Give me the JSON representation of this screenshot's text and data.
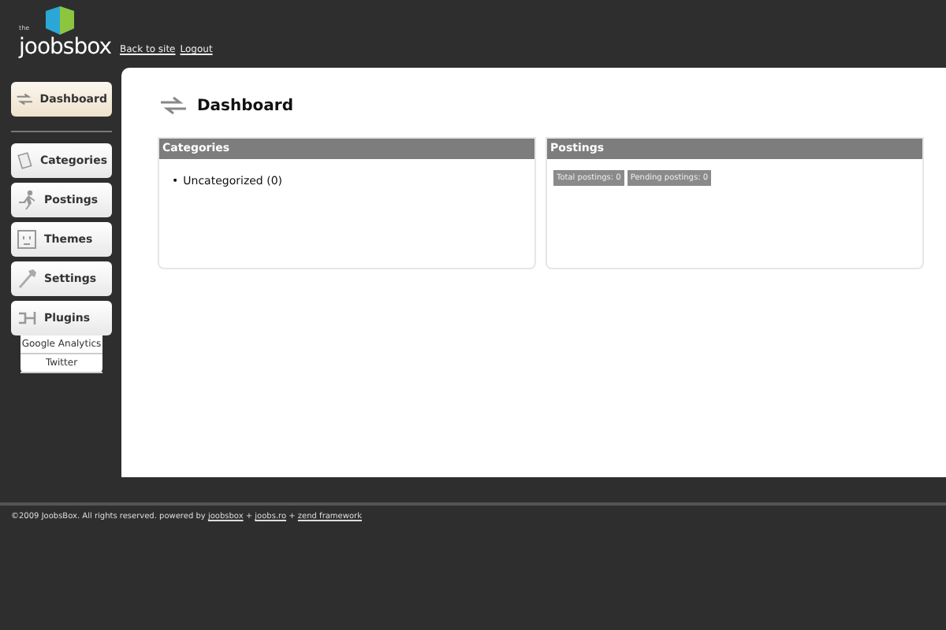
{
  "header": {
    "logo_small": "the",
    "logo": "joobsbox",
    "links": [
      "Back to site",
      "Logout"
    ]
  },
  "sidebar": {
    "items": [
      {
        "label": "Dashboard",
        "selected": true
      },
      {
        "label": "Categories",
        "selected": false
      },
      {
        "label": "Postings",
        "selected": false
      },
      {
        "label": "Themes",
        "selected": false
      },
      {
        "label": "Settings",
        "selected": false
      },
      {
        "label": "Plugins",
        "selected": false
      }
    ],
    "subitems": [
      "Google Analytics",
      "Twitter"
    ]
  },
  "page": {
    "title": "Dashboard"
  },
  "panels": [
    {
      "title": "Categories",
      "kind": "list",
      "marker": "•",
      "items": [
        "Uncategorized (0)"
      ]
    },
    {
      "title": "Postings",
      "kind": "tags",
      "items": [
        "Total postings: 0",
        "Pending postings: 0"
      ]
    }
  ],
  "footer": {
    "text": "©2009 JoobsBox. All rights reserved. powered by",
    "separator": "+",
    "links": [
      "joobsbox",
      "joobs.ro",
      "zend framework"
    ]
  }
}
